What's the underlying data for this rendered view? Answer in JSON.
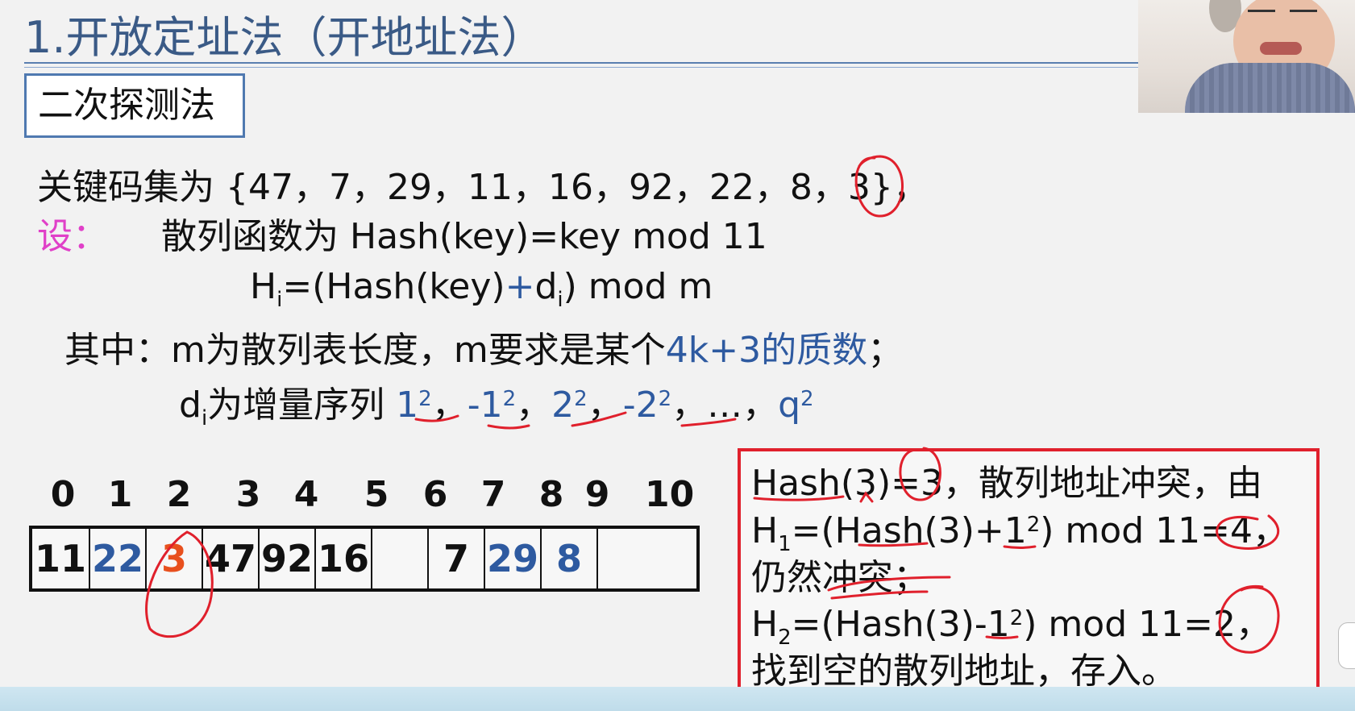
{
  "slide": {
    "title": "1.开放定址法（开地址法）",
    "method": "二次探测法",
    "keyset_label": "关键码集为 ",
    "keys": "{47，7，29，11，16，92，22，8，3}，",
    "let_label": "设：",
    "hash_fn": "散列函数为  Hash(key)=key mod 11",
    "hi_H": "H",
    "hi_i": "i",
    "hi_mid": "=(Hash(key)",
    "hi_plus": "+",
    "hi_d": "d",
    "hi_di": "i",
    "hi_end": ") mod m",
    "where_label": "其中：",
    "where_text": "m为散列表长度，m要求是某个",
    "where_blue": "4k+3的质数",
    "where_end": "；",
    "di_d": "d",
    "di_i": "i",
    "di_text": "为增量序列 ",
    "seq": [
      {
        "base": "1",
        "exp": "2",
        "sep": "，"
      },
      {
        "base": "-1",
        "exp": "2",
        "sep": "，"
      },
      {
        "base": "2",
        "exp": "2",
        "sep": "，"
      },
      {
        "base": "-2",
        "exp": "2",
        "sep": "，"
      },
      {
        "base": "…",
        "exp": "",
        "sep": "，"
      },
      {
        "base": "q",
        "exp": "2",
        "sep": ""
      }
    ]
  },
  "table": {
    "indices": [
      "0",
      "1",
      "2",
      "3",
      "4",
      "5",
      "6",
      "7",
      "8",
      "9",
      "10"
    ],
    "cells": [
      "11",
      "22",
      "3",
      "47",
      "92",
      "16",
      "",
      "7",
      "29",
      "8",
      ""
    ],
    "cell_colors": [
      "#111111",
      "#2e5aa0",
      "#e8501e",
      "#111111",
      "#111111",
      "#111111",
      "#111111",
      "#111111",
      "#2e5aa0",
      "#2e5aa0",
      "#111111"
    ]
  },
  "explain": {
    "l1": "Hash(3)=3，散列地址冲突，由",
    "l2_a": "H",
    "l2_sub": "1",
    "l2_b": "=(Hash(3)+1",
    "l2_sup": "2",
    "l2_c": ") mod 11=4，",
    "l3": "仍然冲突；",
    "l4_a": "H",
    "l4_sub": "2",
    "l4_b": "=(Hash(3)-1",
    "l4_sup": "2",
    "l4_c": ") mod 11=2，",
    "l5": "找到空的散列地址，存入。"
  },
  "colors": {
    "title": "#3a5a86",
    "accent_blue": "#2e5aa0",
    "pink": "#e040c8",
    "red_box": "#e0202c",
    "ink_red": "#e0202c"
  }
}
